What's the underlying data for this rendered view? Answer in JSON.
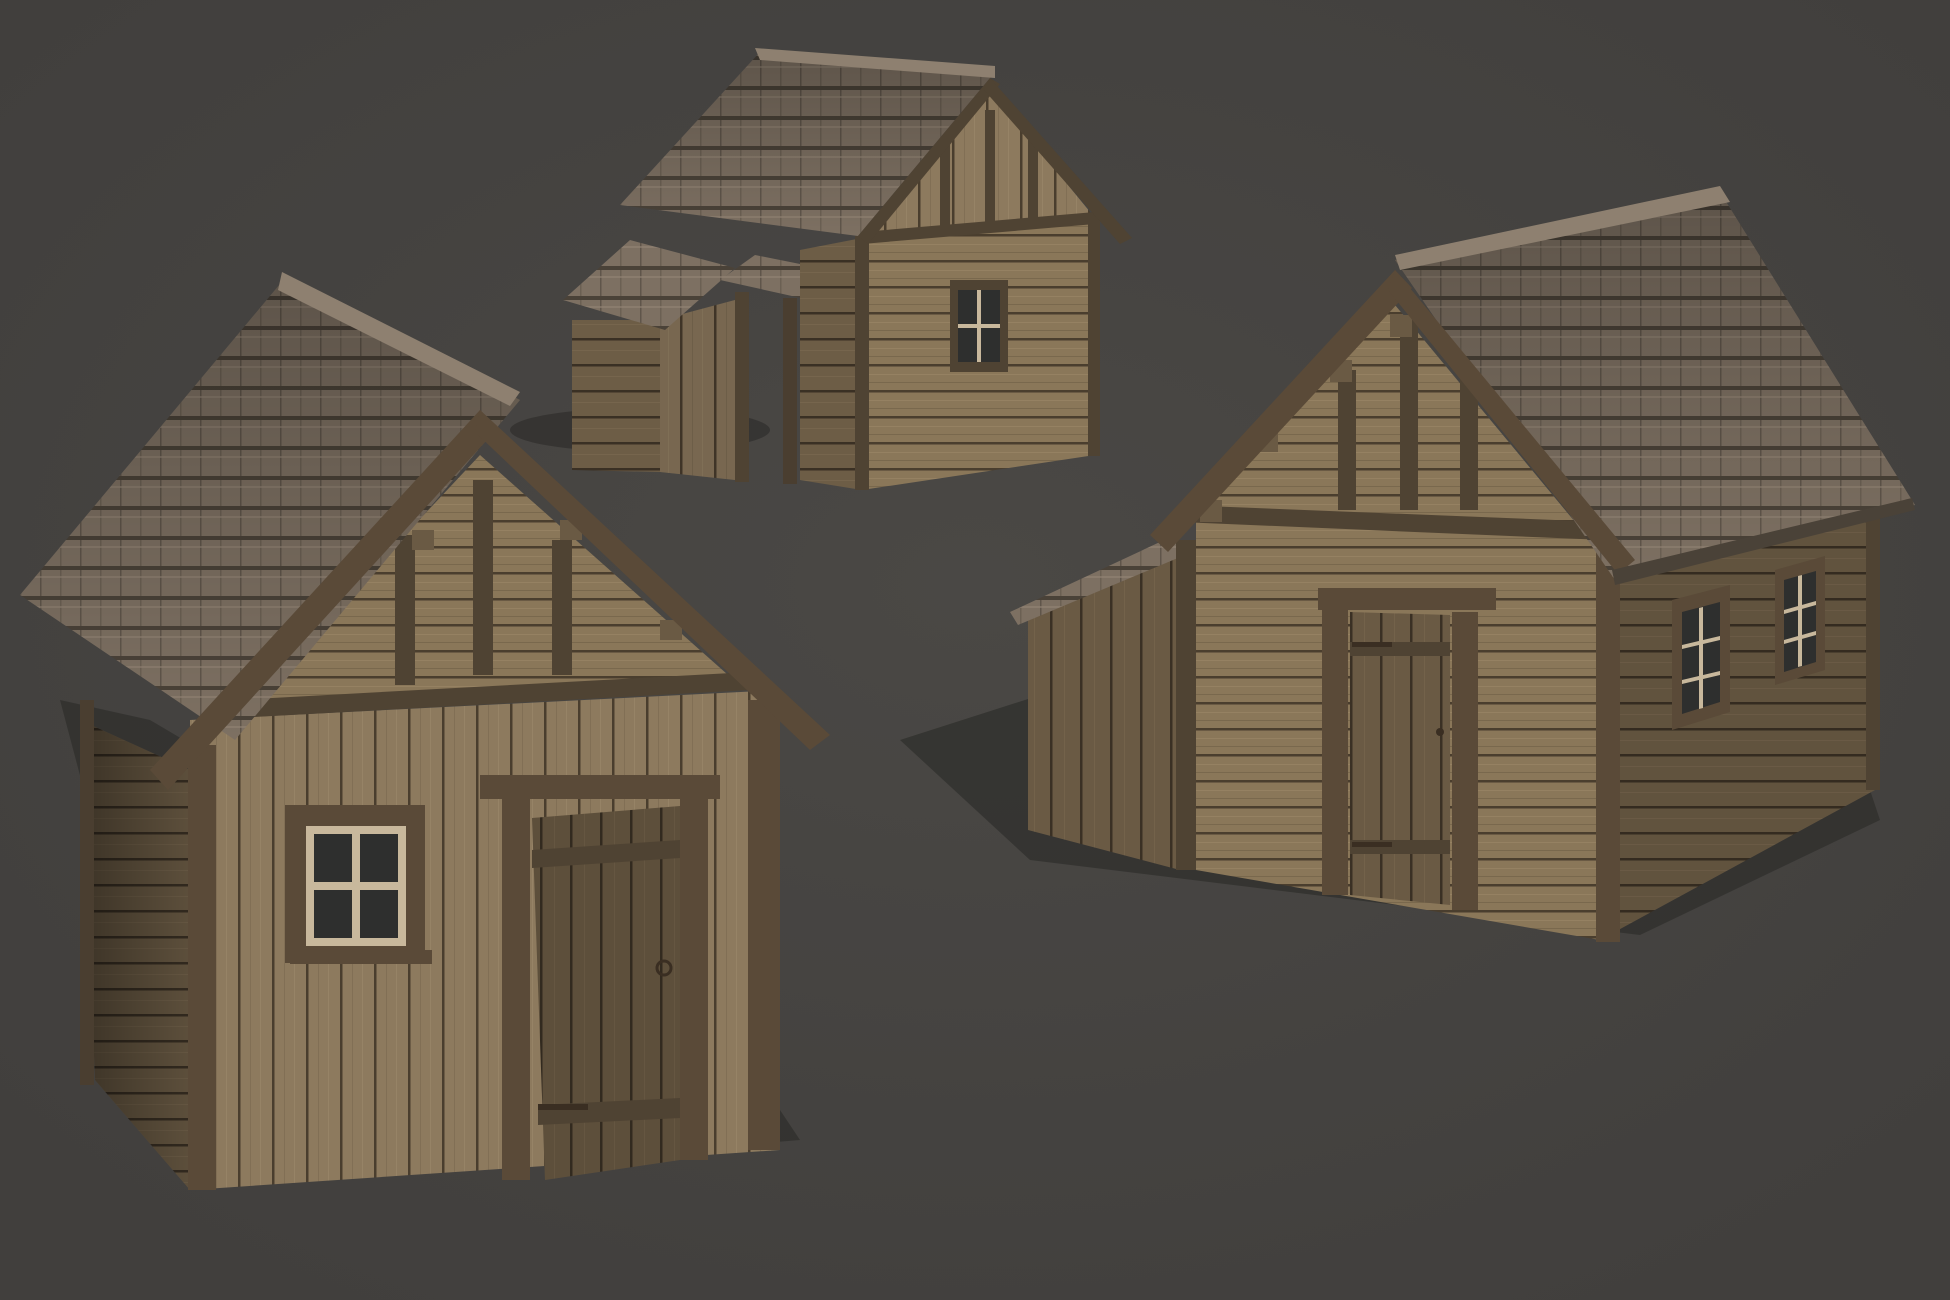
{
  "scene": {
    "background": "#413f3d",
    "background_glow": "#4a4845",
    "shadow": "#2b2a28",
    "wood_light": "#9e8a6c",
    "wood_mid": "#7e6c52",
    "wood_dark": "#4f4333",
    "beam": "#5a4a38",
    "roof_light": "#8e8070",
    "roof_mid": "#6e6254",
    "roof_dark": "#4a4238",
    "glass": "#2e2f2e",
    "frame_trim": "#c8b89c",
    "door_hardware": "#3a2e22"
  },
  "houses": [
    {
      "name": "small-cabin-back",
      "door": "hidden",
      "window_panes": 4
    },
    {
      "name": "vertical-plank-shed-left",
      "door": "ajar",
      "window_panes": 4
    },
    {
      "name": "horizontal-plank-cottage-right",
      "door": "closed",
      "window_panes": 6
    }
  ]
}
